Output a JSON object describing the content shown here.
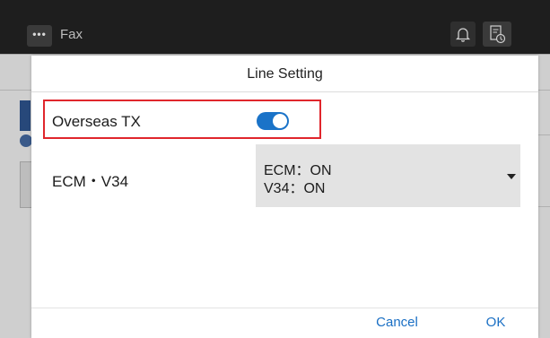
{
  "app": {
    "title": "Fax",
    "menu_icon": "more-dots-icon",
    "notification_icon": "bell-icon",
    "job_status_icon": "job-status-icon"
  },
  "dialog": {
    "title": "Line Setting",
    "settings": [
      {
        "label": "Overseas  TX",
        "type": "toggle",
        "value": "on"
      },
      {
        "label": "ECM・V34",
        "type": "select",
        "value_lines": [
          "ECM：ON",
          "V34：ON"
        ],
        "dropdown_icon": "caret-down-icon"
      }
    ],
    "buttons": {
      "cancel": "Cancel",
      "ok": "OK"
    }
  },
  "colors": {
    "accent": "#1a73c8",
    "highlight_border": "#e0262c",
    "header_bg": "#1e1e1e",
    "select_bg": "#e3e3e3"
  }
}
